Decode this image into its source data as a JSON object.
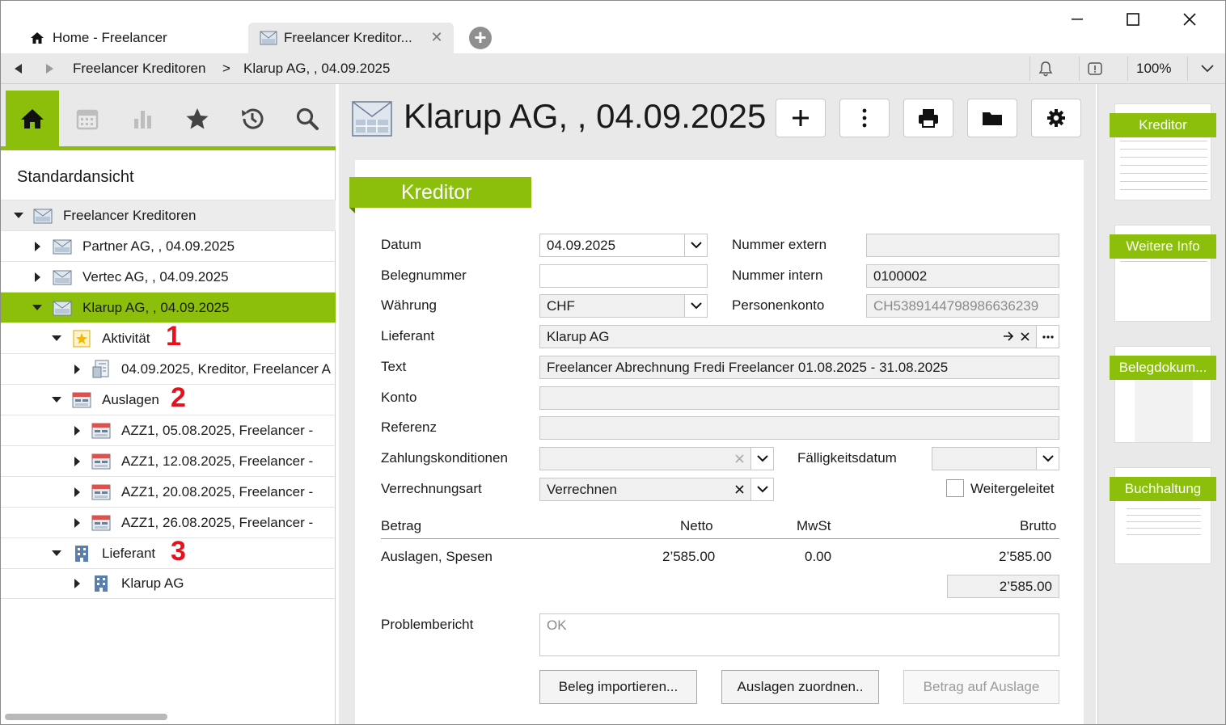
{
  "tabs": [
    {
      "label": "Home - Freelancer",
      "icon": "home-icon"
    },
    {
      "label": "Freelancer Kreditor...",
      "icon": "kreditor-icon"
    }
  ],
  "addressbar": {
    "crumb1": "Freelancer Kreditoren",
    "separator": ">",
    "crumb2": "Klarup AG, , 04.09.2025",
    "zoom": "100%"
  },
  "left": {
    "view_title": "Standardansicht",
    "tree": [
      {
        "label": "Freelancer Kreditoren",
        "level": 0,
        "expanded": true
      },
      {
        "label": "Partner AG, , 04.09.2025",
        "level": 1
      },
      {
        "label": "Vertec AG, , 04.09.2025",
        "level": 1
      },
      {
        "label": "Klarup AG, , 04.09.2025",
        "level": 1,
        "selected": true
      },
      {
        "label": "Aktivität",
        "level": 2,
        "mark": "1"
      },
      {
        "label": "04.09.2025, Kreditor, Freelancer A",
        "level": 3
      },
      {
        "label": "Auslagen",
        "level": 2,
        "mark": "2"
      },
      {
        "label": "AZZ1, 05.08.2025, Freelancer -",
        "level": 3
      },
      {
        "label": "AZZ1, 12.08.2025, Freelancer -",
        "level": 3
      },
      {
        "label": "AZZ1, 20.08.2025, Freelancer -",
        "level": 3
      },
      {
        "label": "AZZ1, 26.08.2025, Freelancer -",
        "level": 3
      },
      {
        "label": "Lieferant",
        "level": 2,
        "mark": "3"
      },
      {
        "label": "Klarup AG",
        "level": 3
      }
    ]
  },
  "main": {
    "title": "Klarup AG, , 04.09.2025",
    "section": "Kreditor",
    "labels": {
      "datum": "Datum",
      "belegnummer": "Belegnummer",
      "waehrung": "Währung",
      "lieferant": "Lieferant",
      "text": "Text",
      "konto": "Konto",
      "referenz": "Referenz",
      "zahlungskonditionen": "Zahlungskonditionen",
      "verrechnungsart": "Verrechnungsart",
      "nummer_extern": "Nummer extern",
      "nummer_intern": "Nummer intern",
      "personenkonto": "Personenkonto",
      "faelligkeitsdatum": "Fälligkeitsdatum",
      "weitergeleitet": "Weitergeleitet",
      "problembericht": "Problembericht"
    },
    "values": {
      "datum": "04.09.2025",
      "belegnummer": "",
      "waehrung": "CHF",
      "lieferant": "Klarup AG",
      "text": "Freelancer Abrechnung Fredi Freelancer 01.08.2025 - 31.08.2025",
      "konto": "",
      "referenz": "",
      "zahlungskonditionen": "",
      "verrechnungsart": "Verrechnen",
      "nummer_extern": "",
      "nummer_intern": "0100002",
      "personenkonto": "CH5389144798986636239",
      "faelligkeitsdatum": "",
      "problembericht": "OK"
    },
    "amounts": {
      "headers": [
        "Betrag",
        "Netto",
        "MwSt",
        "Brutto"
      ],
      "row": {
        "label": "Auslagen, Spesen",
        "netto": "2’585.00",
        "mwst": "0.00",
        "brutto": "2’585.00"
      },
      "total": "2’585.00"
    },
    "buttons": {
      "import": "Beleg importieren...",
      "assign": "Auslagen zuordnen..",
      "amount": "Betrag auf Auslage"
    }
  },
  "right": {
    "pages": [
      "Kreditor",
      "Weitere Info",
      "Belegdokum...",
      "Buchhaltung"
    ]
  },
  "colors": {
    "accent": "#8bbf0c",
    "mark": "#e8101b",
    "panel": "#e9e9e9"
  }
}
